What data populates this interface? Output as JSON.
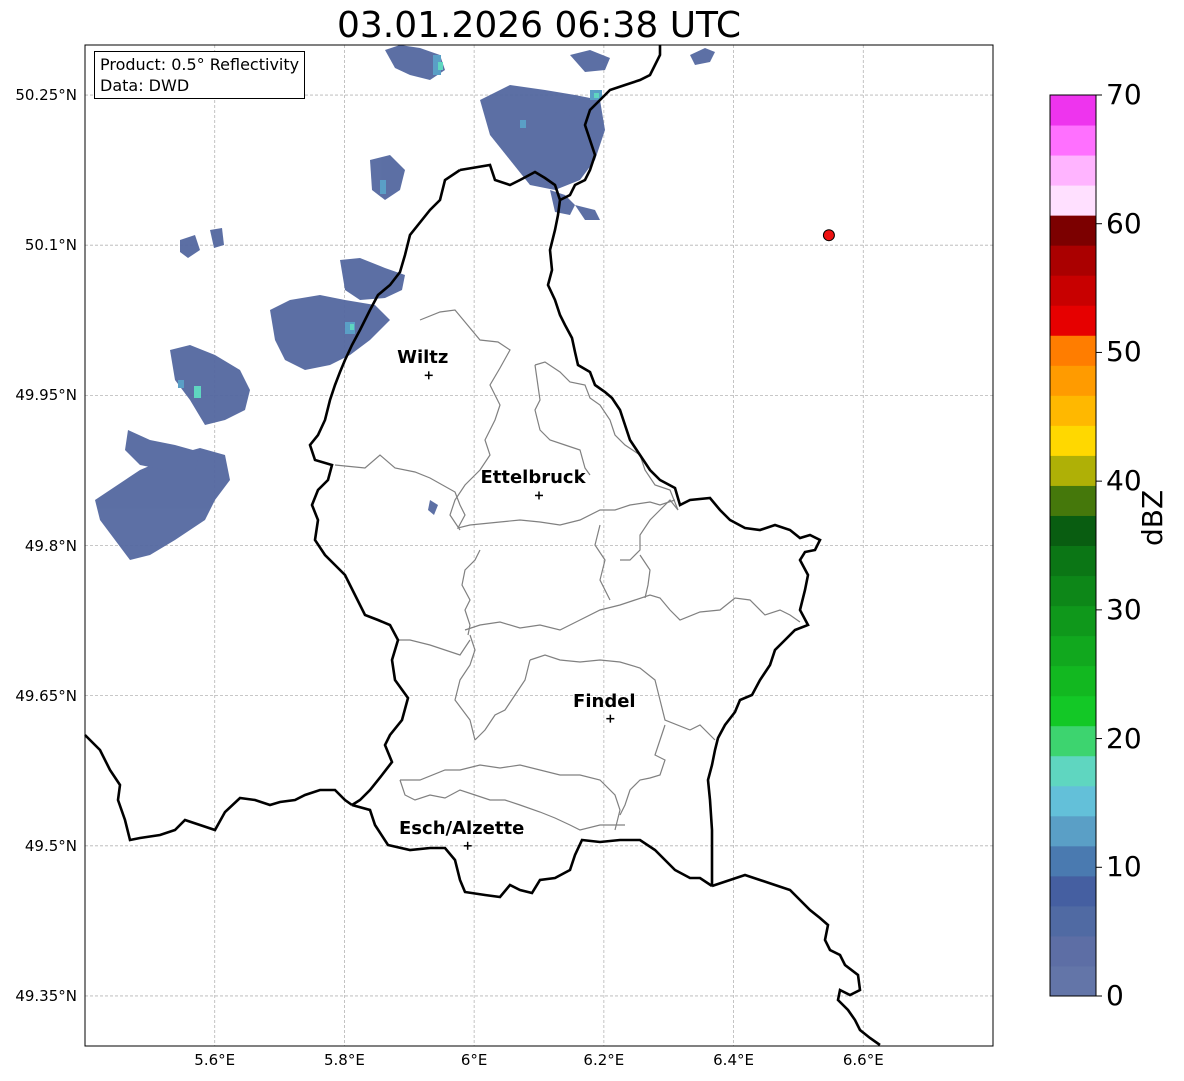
{
  "title": "03.01.2026 06:38 UTC",
  "info_box": {
    "product": "Product: 0.5° Reflectivity",
    "data": "Data: DWD"
  },
  "map": {
    "lon_range": [
      5.4,
      6.8
    ],
    "lat_range": [
      49.3,
      50.3
    ],
    "lat_ticks": [
      {
        "value": 50.25,
        "label": "50.25°N"
      },
      {
        "value": 50.1,
        "label": "50.1°N"
      },
      {
        "value": 49.95,
        "label": "49.95°N"
      },
      {
        "value": 49.8,
        "label": "49.8°N"
      },
      {
        "value": 49.65,
        "label": "49.65°N"
      },
      {
        "value": 49.5,
        "label": "49.5°N"
      },
      {
        "value": 49.35,
        "label": "49.35°N"
      }
    ],
    "lon_ticks": [
      {
        "value": 5.6,
        "label": "5.6°E"
      },
      {
        "value": 5.8,
        "label": "5.8°E"
      },
      {
        "value": 6.0,
        "label": "6°E"
      },
      {
        "value": 6.2,
        "label": "6.2°E"
      },
      {
        "value": 6.4,
        "label": "6.4°E"
      },
      {
        "value": 6.6,
        "label": "6.6°E"
      }
    ],
    "grid": true,
    "cities": [
      {
        "name": "Wiltz",
        "lon": 5.93,
        "lat": 49.97
      },
      {
        "name": "Ettelbruck",
        "lon": 6.1,
        "lat": 49.85
      },
      {
        "name": "Findel",
        "lon": 6.21,
        "lat": 49.627
      },
      {
        "name": "Esch/Alzette",
        "lon": 5.99,
        "lat": 49.5
      }
    ],
    "radar_site": {
      "lon": 6.547,
      "lat": 50.11,
      "color": "#ee1111"
    }
  },
  "colorbar": {
    "label": "dBZ",
    "ticks": [
      {
        "value": 70,
        "label": "70"
      },
      {
        "value": 60,
        "label": "60"
      },
      {
        "value": 50,
        "label": "50"
      },
      {
        "value": 40,
        "label": "40"
      },
      {
        "value": 30,
        "label": "30"
      },
      {
        "value": 20,
        "label": "20"
      },
      {
        "value": 10,
        "label": "10"
      },
      {
        "value": 0,
        "label": "0"
      }
    ],
    "colors": [
      "#6375a8",
      "#5d6ea5",
      "#506aa3",
      "#455fa1",
      "#4a7ab0",
      "#5a9fc6",
      "#63c0d9",
      "#5fd6c0",
      "#3dd46f",
      "#13c826",
      "#12b820",
      "#11a81e",
      "#0f981b",
      "#0d8718",
      "#0b7615",
      "#095d11",
      "#45780b",
      "#afb006",
      "#ffd800",
      "#ffb800",
      "#ff9b00",
      "#ff7d00",
      "#e60000",
      "#c80000",
      "#aa0000",
      "#7c0000",
      "#ffe0ff",
      "#ffb4ff",
      "#ff70ff",
      "#ee34ee"
    ]
  }
}
